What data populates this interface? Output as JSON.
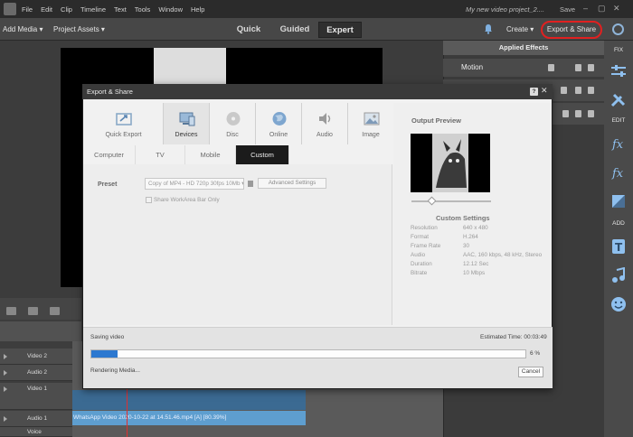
{
  "menu": {
    "items": [
      "File",
      "Edit",
      "Clip",
      "Timeline",
      "Text",
      "Tools",
      "Window",
      "Help"
    ],
    "project_title": "My new video project_2....",
    "save": "Save"
  },
  "toolbar": {
    "add_media": "Add Media",
    "project_assets": "Project Assets",
    "modes": [
      "Quick",
      "Guided",
      "Expert"
    ],
    "active_mode": "Expert",
    "create": "Create",
    "export_share": "Export & Share"
  },
  "panel": {
    "applied_effects": "Applied Effects",
    "motion": "Motion"
  },
  "rail": {
    "fix": "FIX",
    "edit": "EDIT",
    "add": "ADD"
  },
  "timeline": {
    "tracks": [
      "Video 2",
      "Audio 2",
      "Video 1",
      "Audio 1",
      "Voice"
    ],
    "audio_clip": "WhatsApp Video 2020-10-22 at 14.51.46.mp4 [A] [80.39%]"
  },
  "dialog": {
    "title": "Export & Share",
    "help": "?",
    "categories": [
      "Quick Export",
      "Devices",
      "Disc",
      "Online",
      "Audio",
      "Image"
    ],
    "active_category": "Devices",
    "subtabs": [
      "Computer",
      "TV",
      "Mobile",
      "Custom"
    ],
    "active_subtab": "Custom",
    "preset_label": "Preset",
    "preset_value": "Copy of MP4 - HD 720p 30fps 10Mb",
    "advanced_settings": "Advanced Settings",
    "workarea_only": "Share WorkArea Bar Only",
    "output_preview": "Output Preview",
    "custom_settings": "Custom Settings",
    "settings": [
      {
        "k": "Resolution",
        "v": "640 x 480"
      },
      {
        "k": "Format",
        "v": "H.264"
      },
      {
        "k": "Frame Rate",
        "v": "30"
      },
      {
        "k": "Audio",
        "v": "AAC, 160 kbps, 48 kHz, Stereo"
      },
      {
        "k": "Duration",
        "v": "12.12 Sec"
      },
      {
        "k": "Bitrate",
        "v": "10 Mbps"
      }
    ],
    "saving_video": "Saving video",
    "estimated_time": "Estimated Time: 00:03:49",
    "progress_percent": 6,
    "progress_label": "6 %",
    "rendering": "Rendering Media...",
    "cancel": "Cancel"
  },
  "colors": {
    "accent": "#2c78d0",
    "highlight_ring": "#e02020"
  },
  "icons": {
    "bell": "bell-icon",
    "gear": "gear-icon",
    "close": "close-icon"
  }
}
